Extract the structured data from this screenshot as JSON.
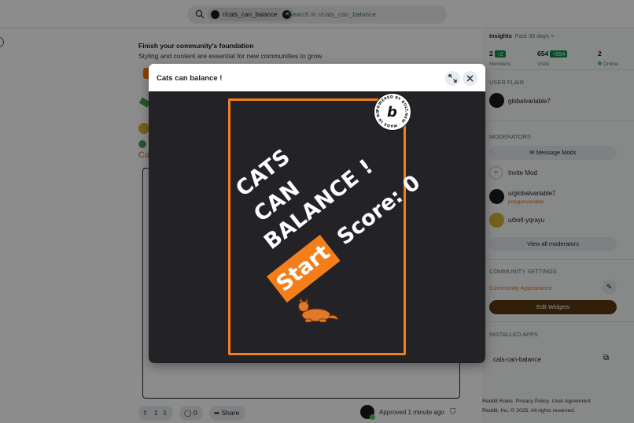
{
  "search": {
    "community_chip": "r/cats_can_balance",
    "placeholder": "Search in r/cats_can_balance"
  },
  "main": {
    "foundation_title": "Finish your community's foundation",
    "foundation_subtitle": "Styling and content are essential for new communities to grow",
    "snippet_letter": "Ca",
    "actions": {
      "vote_count": "1",
      "comments_count": "0",
      "share_label": "Share"
    },
    "approved_text": "Approved 1 minute ago"
  },
  "sidebar": {
    "insights_label": "Insights",
    "insights_period": "Past 30 days >",
    "stats": {
      "members_value": "2",
      "members_delta": "2",
      "members_label": "Members",
      "visits_value": "654",
      "visits_delta": "654",
      "visits_label": "Visits",
      "online_value": "2",
      "online_label": "Online"
    },
    "user_flair_heading": "USER FLAIR",
    "user_flair_name": "globalvariable7",
    "moderators_heading": "MODERATORS",
    "message_mods_label": "Message Mods",
    "invite_mod_label": "Invite Mod",
    "mod1_name": "u/globalvariable7",
    "mod1_flair": "polygonvariable",
    "mod2_name": "u/bolt-yqrayu",
    "view_all_label": "View all moderators",
    "community_settings_heading": "COMMUNITY SETTINGS",
    "community_appearance_label": "Community Appearance",
    "edit_widgets_label": "Edit Widgets",
    "installed_apps_heading": "INSTALLED APPS",
    "app_name": "cats-can-balance",
    "footer_links": [
      "Reddit Rules",
      "Privacy Policy",
      "User Agreement"
    ],
    "footer_copyright": "Reddit, Inc. © 2025. All rights reserved."
  },
  "modal": {
    "title": "Cats can balance !",
    "game": {
      "title_lines": [
        "CATS",
        "CAN",
        "BALANCE !"
      ],
      "start_label": "Start",
      "score_label": "Score: 0",
      "badge_text": "POWERED BY BOLT.NEW · MADE IN BOLT.NEW ·",
      "badge_letter": "b"
    }
  },
  "colors": {
    "accent_orange": "#f47f1a",
    "game_bg": "#232227",
    "positive_green": "#0e8a4a",
    "dark_button": "#5c3a12"
  },
  "icons": [
    "search-icon",
    "close-icon",
    "expand-icon",
    "upvote-icon",
    "downvote-icon",
    "comment-icon",
    "share-icon",
    "shield-icon",
    "external-link-icon",
    "pencil-icon",
    "mail-icon",
    "plus-icon",
    "cat-icon",
    "bolt-logo-icon"
  ]
}
